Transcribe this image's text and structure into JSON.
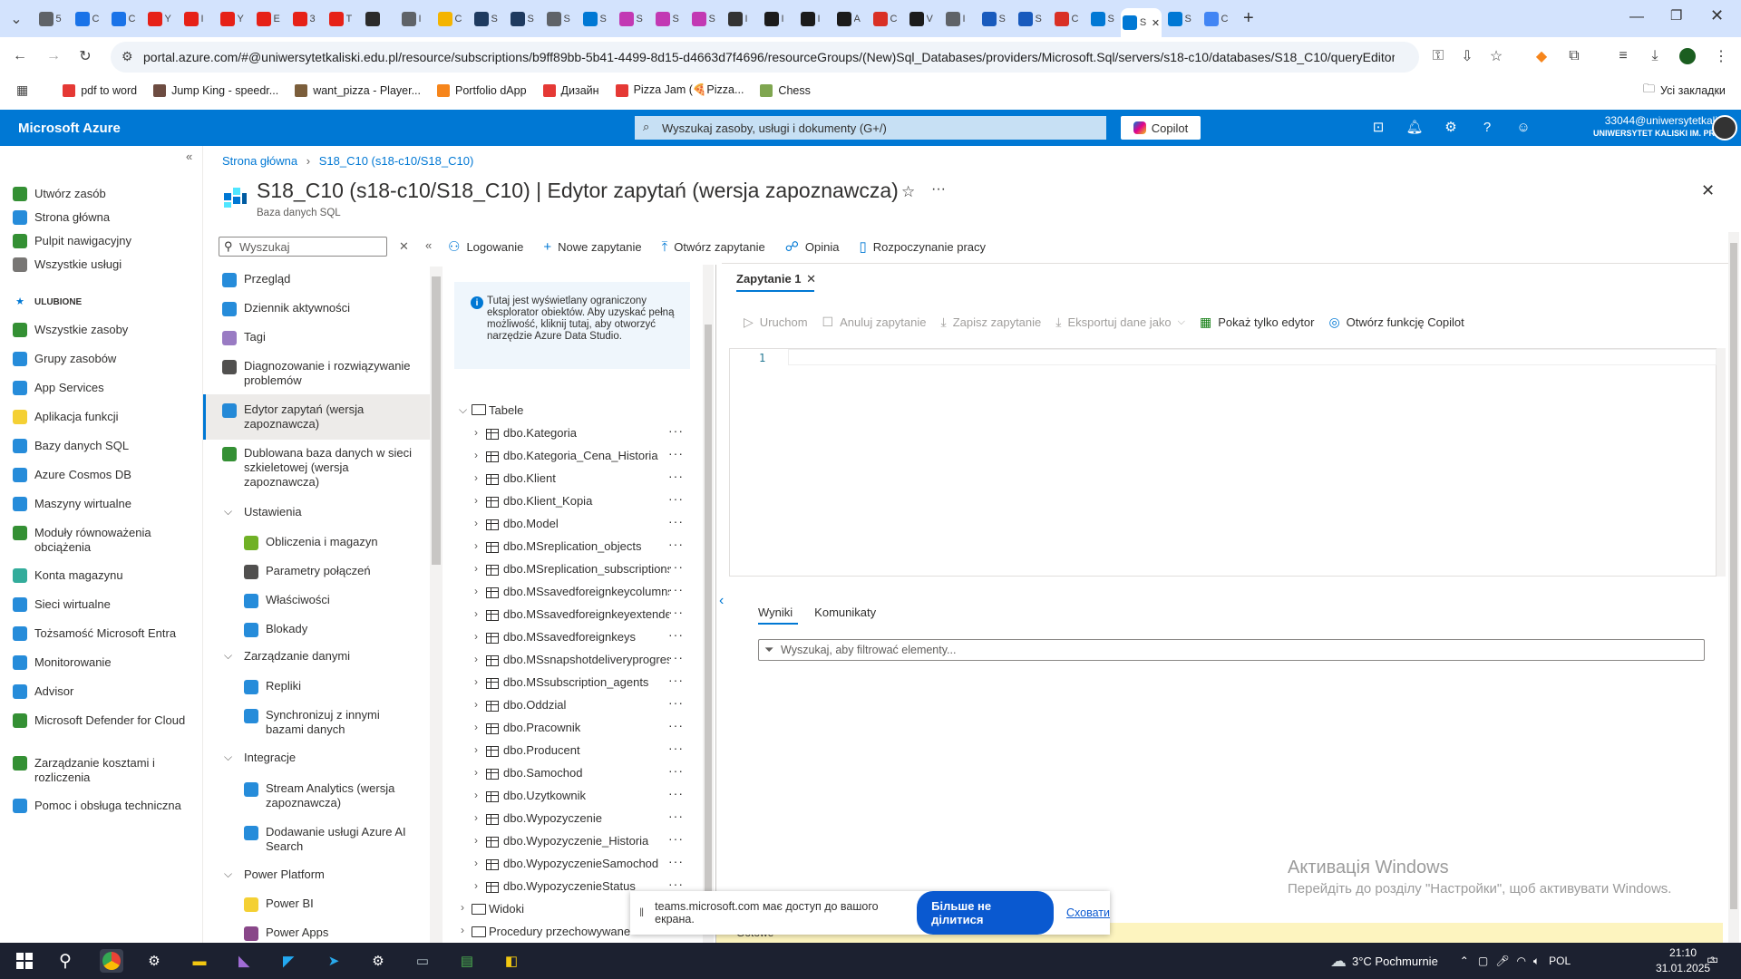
{
  "browser": {
    "tabs": [
      {
        "title": "5",
        "color": "#5f6368"
      },
      {
        "title": "C",
        "color": "#1a73e8"
      },
      {
        "title": "C",
        "color": "#1a73e8"
      },
      {
        "title": "Y",
        "color": "#e62117"
      },
      {
        "title": "I",
        "color": "#e62117"
      },
      {
        "title": "Y",
        "color": "#e62117"
      },
      {
        "title": "E",
        "color": "#e62117"
      },
      {
        "title": "3",
        "color": "#e62117"
      },
      {
        "title": "T",
        "color": "#e62117"
      },
      {
        "title": "",
        "color": "#2b2b2b"
      },
      {
        "title": "I",
        "color": "#5f6368"
      },
      {
        "title": "C",
        "color": "#f4b400"
      },
      {
        "title": "S",
        "color": "#1e3a5f"
      },
      {
        "title": "S",
        "color": "#1e3a5f"
      },
      {
        "title": "S",
        "color": "#5f6368"
      },
      {
        "title": "S",
        "color": "#0078d4"
      },
      {
        "title": "S",
        "color": "#c239b3"
      },
      {
        "title": "S",
        "color": "#c239b3"
      },
      {
        "title": "S",
        "color": "#c239b3"
      },
      {
        "title": "I",
        "color": "#333333"
      },
      {
        "title": "I",
        "color": "#1b1b1b"
      },
      {
        "title": "I",
        "color": "#1b1b1b"
      },
      {
        "title": "A",
        "color": "#1b1b1b"
      },
      {
        "title": "C",
        "color": "#d93025"
      },
      {
        "title": "V",
        "color": "#1b1b1b"
      },
      {
        "title": "I",
        "color": "#5f6368"
      },
      {
        "title": "S",
        "color": "#185abd"
      },
      {
        "title": "S",
        "color": "#185abd"
      },
      {
        "title": "C",
        "color": "#d93025"
      },
      {
        "title": "S",
        "color": "#0078d4"
      },
      {
        "title": "S",
        "color": "#0078d4",
        "active": true
      },
      {
        "title": "S",
        "color": "#0078d4"
      },
      {
        "title": "C",
        "color": "#4285f4"
      }
    ],
    "url": "portal.azure.com/#@uniwersytetkaliski.edu.pl/resource/subscriptions/b9ff89bb-5b41-4499-8d15-d4663d7f4696/resourceGroups/(New)Sql_Databases/providers/Microsoft.Sql/servers/s18-c10/databases/S18_C10/queryEditor",
    "bookmarks": [
      {
        "label": "pdf to word",
        "color": "#e53935"
      },
      {
        "label": "Jump King - speedr...",
        "color": "#6d4c41"
      },
      {
        "label": "want_pizza - Player...",
        "color": "#7b5e3b"
      },
      {
        "label": "Portfolio dApp",
        "color": "#f6851b"
      },
      {
        "label": "Дизайн",
        "color": "#e53935"
      },
      {
        "label": "Pizza Jam (🍕Pizza...",
        "color": "#e53935"
      },
      {
        "label": "Chess",
        "color": "#7fa650"
      }
    ],
    "all_bookmarks": "Усі закладки"
  },
  "azure": {
    "brand": "Microsoft Azure",
    "search_placeholder": "Wyszukaj zasoby, usługi i dokumenty (G+/)",
    "copilot": "Copilot",
    "user_email": "33044@uniwersytetkalis...",
    "user_org": "UNIWERSYTET KALISKI IM. PREZ...",
    "colors": {
      "header": "#0078d4",
      "accent": "#0078d4"
    }
  },
  "leftnav": {
    "items": [
      {
        "label": "Utwórz zasób",
        "icon": "plus-icon",
        "color": "#107c10"
      },
      {
        "label": "Strona główna",
        "icon": "home-icon",
        "color": "#0078d4"
      },
      {
        "label": "Pulpit nawigacyjny",
        "icon": "dashboard-icon",
        "color": "#107c10"
      },
      {
        "label": "Wszystkie usługi",
        "icon": "list-icon",
        "color": "#605e5c"
      },
      {
        "label": "ULUBIONE",
        "icon": "star-icon",
        "color": "#0078d4",
        "section": true
      },
      {
        "label": "Wszystkie zasoby",
        "icon": "grid-icon",
        "color": "#107c10"
      },
      {
        "label": "Grupy zasobów",
        "icon": "resource-group-icon",
        "color": "#0078d4"
      },
      {
        "label": "App Services",
        "icon": "globe-icon",
        "color": "#0078d4"
      },
      {
        "label": "Aplikacja funkcji",
        "icon": "lightning-icon",
        "color": "#f2c811"
      },
      {
        "label": "Bazy danych SQL",
        "icon": "sql-database-icon",
        "color": "#0078d4"
      },
      {
        "label": "Azure Cosmos DB",
        "icon": "cosmos-db-icon",
        "color": "#0078d4"
      },
      {
        "label": "Maszyny wirtualne",
        "icon": "vm-icon",
        "color": "#0078d4"
      },
      {
        "label": "Moduły równoważenia obciążenia",
        "icon": "load-balancer-icon",
        "color": "#107c10"
      },
      {
        "label": "Konta magazynu",
        "icon": "storage-icon",
        "color": "#0f9d8a"
      },
      {
        "label": "Sieci wirtualne",
        "icon": "network-icon",
        "color": "#0078d4"
      },
      {
        "label": "Tożsamość Microsoft Entra",
        "icon": "entra-icon",
        "color": "#0078d4"
      },
      {
        "label": "Monitorowanie",
        "icon": "monitor-icon",
        "color": "#0078d4"
      },
      {
        "label": "Advisor",
        "icon": "advisor-icon",
        "color": "#0078d4"
      },
      {
        "label": "Microsoft Defender for Cloud",
        "icon": "shield-icon",
        "color": "#107c10"
      },
      {
        "label": "Zarządzanie kosztami i rozliczenia",
        "icon": "cost-icon",
        "color": "#107c10"
      },
      {
        "label": "Pomoc i obsługa techniczna",
        "icon": "help-icon",
        "color": "#0078d4"
      }
    ]
  },
  "blade": {
    "breadcrumb": [
      "Strona główna",
      "S18_C10 (s18-c10/S18_C10)"
    ],
    "title": "S18_C10 (s18-c10/S18_C10) | Edytor zapytań (wersja zapoznawcza)",
    "subtitle": "Baza danych SQL"
  },
  "resource_menu": {
    "search_placeholder": "Wyszukaj",
    "items": [
      {
        "label": "Przegląd",
        "icon": "overview-icon",
        "color": "#0078d4"
      },
      {
        "label": "Dziennik aktywności",
        "icon": "activity-log-icon",
        "color": "#0078d4"
      },
      {
        "label": "Tagi",
        "icon": "tag-icon",
        "color": "#8764b8"
      },
      {
        "label": "Diagnozowanie i rozwiązywanie problemów",
        "icon": "wrench-icon",
        "color": "#323130"
      },
      {
        "label": "Edytor zapytań (wersja zapoznawcza)",
        "icon": "query-editor-icon",
        "color": "#0078d4",
        "selected": true
      },
      {
        "label": "Dublowana baza danych w sieci szkieletowej (wersja zapoznawcza)",
        "icon": "fabric-icon",
        "color": "#107c10"
      }
    ],
    "sections": [
      {
        "label": "Ustawienia",
        "items": [
          {
            "label": "Obliczenia i magazyn",
            "icon": "compute-icon",
            "color": "#57a300"
          },
          {
            "label": "Parametry połączeń",
            "icon": "connection-icon",
            "color": "#323130"
          },
          {
            "label": "Właściwości",
            "icon": "properties-icon",
            "color": "#0078d4"
          },
          {
            "label": "Blokady",
            "icon": "lock-icon",
            "color": "#0078d4"
          }
        ]
      },
      {
        "label": "Zarządzanie danymi",
        "items": [
          {
            "label": "Repliki",
            "icon": "replica-icon",
            "color": "#0078d4"
          },
          {
            "label": "Synchronizuj z innymi bazami danych",
            "icon": "sync-icon",
            "color": "#0078d4"
          }
        ]
      },
      {
        "label": "Integracje",
        "items": [
          {
            "label": "Stream Analytics (wersja zapoznawcza)",
            "icon": "stream-analytics-icon",
            "color": "#0078d4"
          },
          {
            "label": "Dodawanie usługi Azure AI Search",
            "icon": "ai-search-icon",
            "color": "#0078d4"
          }
        ]
      },
      {
        "label": "Power Platform",
        "items": [
          {
            "label": "Power BI",
            "icon": "power-bi-icon",
            "color": "#f2c811"
          },
          {
            "label": "Power Apps",
            "icon": "power-apps-icon",
            "color": "#742774"
          }
        ]
      }
    ]
  },
  "query_editor": {
    "commands": [
      {
        "label": "Logowanie",
        "icon": "person-icon"
      },
      {
        "label": "Nowe zapytanie",
        "icon": "plus-icon"
      },
      {
        "label": "Otwórz zapytanie",
        "icon": "upload-icon"
      },
      {
        "label": "Opinia",
        "icon": "feedback-icon"
      },
      {
        "label": "Rozpoczynanie pracy",
        "icon": "book-icon"
      }
    ],
    "info": "Tutaj jest wyświetlany ograniczony eksplorator obiektów. Aby uzyskać pełną możliwość, kliknij tutaj, aby otworzyć narzędzie Azure Data Studio.",
    "tree": {
      "tables_label": "Tabele",
      "tables": [
        "dbo.Kategoria",
        "dbo.Kategoria_Cena_Historia",
        "dbo.Klient",
        "dbo.Klient_Kopia",
        "dbo.Model",
        "dbo.MSreplication_objects",
        "dbo.MSreplication_subscriptions",
        "dbo.MSsavedforeignkeycolumns",
        "dbo.MSsavedforeignkeyextended",
        "dbo.MSsavedforeignkeys",
        "dbo.MSsnapshotdeliveryprogress",
        "dbo.MSsubscription_agents",
        "dbo.Oddzial",
        "dbo.Pracownik",
        "dbo.Producent",
        "dbo.Samochod",
        "dbo.Uzytkownik",
        "dbo.Wypozyczenie",
        "dbo.Wypozyczenie_Historia",
        "dbo.WypozyczenieSamochod",
        "dbo.WypozyczenieStatus"
      ],
      "views_label": "Widoki",
      "procs_label": "Procedury przechowywane"
    },
    "tab": "Zapytanie 1",
    "toolbar": [
      {
        "label": "Uruchom",
        "icon": "play-icon",
        "enabled": false
      },
      {
        "label": "Anuluj zapytanie",
        "icon": "stop-icon",
        "enabled": false
      },
      {
        "label": "Zapisz zapytanie",
        "icon": "download-icon",
        "enabled": false
      },
      {
        "label": "Eksportuj dane jako",
        "icon": "export-icon",
        "enabled": false
      },
      {
        "label": "Pokaż tylko edytor",
        "icon": "grid-icon",
        "enabled": true
      },
      {
        "label": "Otwórz funkcję Copilot",
        "icon": "copilot-icon",
        "enabled": true
      }
    ],
    "line_number": "1",
    "results_tabs": [
      "Wyniki",
      "Komunikaty"
    ],
    "filter_placeholder": "Wyszukaj, aby filtrować elementy...",
    "status": "Gotowe"
  },
  "overlay": {
    "watermark_title": "Активація Windows",
    "watermark_sub": "Перейдіть до розділу \"Настройки\", щоб активувати Windows.",
    "share_text": "teams.microsoft.com має доступ до вашого екрана.",
    "stop_share": "Більше не ділитися",
    "hide": "Сховати"
  },
  "taskbar": {
    "weather": "3°C Pochmurnie",
    "lang": "POL",
    "time": "21:10",
    "date": "31.01.2025",
    "notifications": "3"
  }
}
